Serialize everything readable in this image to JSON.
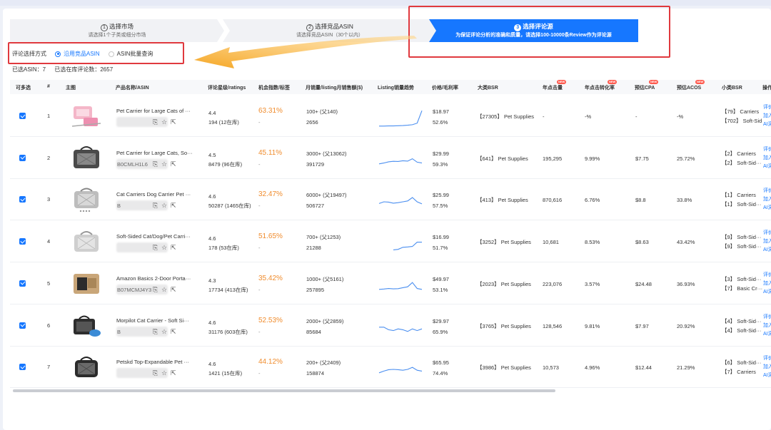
{
  "steps": [
    {
      "num": "1",
      "title": "选择市场",
      "sub": "请选择1个子类或细分市场"
    },
    {
      "num": "2",
      "title": "选择竞品ASIN",
      "sub": "请选择竞品ASIN（30个以内）"
    },
    {
      "num": "3",
      "title": "选择评论源",
      "sub": "为保证评论分析的准确和质量，请选择100-10000条Review作为评论源"
    }
  ],
  "method": {
    "label": "评论选择方式",
    "options": [
      "沿用竞品ASIN",
      "ASIN批量查询"
    ],
    "selected": "沿用竞品ASIN"
  },
  "counts": {
    "asin": "已选ASIN：7",
    "reviews": "已选在库评论数：2657"
  },
  "columns": {
    "select": "可多选",
    "index": "#",
    "image": "主图",
    "name": "产品名称/ASIN",
    "rating": "评论星级/ratings",
    "opp": "机会指数/标签",
    "sales": "月销量/listing月销售额($)",
    "trend": "Listing销量趋势",
    "price": "价格/毛利率",
    "bsr": "大类BSR",
    "clicks": "年点击量",
    "ctr": "年点击转化率",
    "cpa": "预估CPA",
    "acos": "预估ACOS",
    "subbsr": "小类BSR",
    "ops": "操作"
  },
  "new_tag": "NEW",
  "rows": [
    {
      "idx": "1",
      "name": "Pet Carrier for Large Cats of ···",
      "asin_prefix": "",
      "rating": "4.4",
      "ratings": "194 (12在库)",
      "opp": "63.31%",
      "opp2": "-",
      "sales": "100+ (父140)",
      "revenue": "2656",
      "price": "$18.97",
      "margin": "52.6%",
      "bsr": "【27305】 Pet Supplies",
      "clicks": "-",
      "ctr": "-%",
      "cpa": "-",
      "acos": "-%",
      "sub1": "【79】 Carriers",
      "sub2": "【702】 Soft-Sid",
      "op1": "评价",
      "op2": "加入",
      "op3": "AI洞",
      "trend": [
        0.05,
        0.05,
        0.06,
        0.06,
        0.07,
        0.08,
        0.1,
        0.13,
        0.22,
        0.95
      ]
    },
    {
      "idx": "2",
      "name": "Pet Carrier for Large Cats, So···",
      "asin_prefix": "B0CMLH1L6",
      "rating": "4.5",
      "ratings": "8479 (96在库)",
      "opp": "45.11%",
      "opp2": "-",
      "sales": "3000+ (父13062)",
      "revenue": "391729",
      "price": "$29.99",
      "margin": "59.3%",
      "bsr": "【641】 Pet Supplies",
      "clicks": "195,295",
      "ctr": "9.99%",
      "cpa": "$7.75",
      "acos": "25.72%",
      "sub1": "【2】 Carriers",
      "sub2": "【2】 Soft-Sid···",
      "op1": "评价",
      "op2": "加入",
      "op3": "AI洞",
      "trend": [
        0.3,
        0.35,
        0.42,
        0.45,
        0.44,
        0.48,
        0.46,
        0.6,
        0.4,
        0.35
      ]
    },
    {
      "idx": "3",
      "name": "Cat Carriers Dog Carrier Pet ···",
      "asin_prefix": "B",
      "rating": "4.6",
      "ratings": "50287 (1465在库)",
      "opp": "32.47%",
      "opp2": "-",
      "sales": "6000+ (父19497)",
      "revenue": "506727",
      "price": "$25.99",
      "margin": "57.5%",
      "bsr": "【413】 Pet Supplies",
      "clicks": "870,616",
      "ctr": "6.76%",
      "cpa": "$8.8",
      "acos": "33.8%",
      "sub1": "【1】 Carriers",
      "sub2": "【1】 Soft-Sid···",
      "op1": "评价",
      "op2": "加入",
      "op3": "AI洞",
      "trend": [
        0.4,
        0.5,
        0.48,
        0.42,
        0.45,
        0.5,
        0.55,
        0.75,
        0.5,
        0.38
      ]
    },
    {
      "idx": "4",
      "name": "Soft-Sided Cat/Dog/Pet Carri···",
      "asin_prefix": "",
      "rating": "4.6",
      "ratings": "178 (53在库)",
      "opp": "51.65%",
      "opp2": "-",
      "sales": "700+ (父1253)",
      "revenue": "21288",
      "price": "$16.99",
      "margin": "51.7%",
      "bsr": "【3252】 Pet Supplies",
      "clicks": "10,681",
      "ctr": "8.53%",
      "cpa": "$8.63",
      "acos": "43.42%",
      "sub1": "【9】 Soft-Sid···",
      "sub2": "【9】 Soft-Sid···",
      "op1": "评价",
      "op2": "加入",
      "op3": "AI洞",
      "trend": [
        null,
        null,
        null,
        0.15,
        0.18,
        0.3,
        0.32,
        0.35,
        0.6,
        0.6
      ]
    },
    {
      "idx": "5",
      "name": "Amazon Basics 2-Door Porta···",
      "asin_prefix": "B07MCMJ4Y3",
      "rating": "4.3",
      "ratings": "17734 (413在库)",
      "opp": "35.42%",
      "opp2": "-",
      "sales": "1000+ (父5161)",
      "revenue": "257895",
      "price": "$49.97",
      "margin": "53.1%",
      "bsr": "【2023】 Pet Supplies",
      "clicks": "223,076",
      "ctr": "3.57%",
      "cpa": "$24.48",
      "acos": "36.93%",
      "sub1": "【3】 Soft-Sid···",
      "sub2": "【7】 Basic Cr···",
      "op1": "评价",
      "op2": "加入",
      "op3": "AI洞",
      "trend": [
        0.3,
        0.32,
        0.35,
        0.33,
        0.34,
        0.4,
        0.45,
        0.7,
        0.35,
        0.3
      ]
    },
    {
      "idx": "6",
      "name": "Morpilot Cat Carrier - Soft Si···",
      "asin_prefix": "B",
      "rating": "4.6",
      "ratings": "31176 (603在库)",
      "opp": "52.53%",
      "opp2": "-",
      "sales": "2000+ (父2859)",
      "revenue": "85684",
      "price": "$29.97",
      "margin": "65.9%",
      "bsr": "【3765】 Pet Supplies",
      "clicks": "128,546",
      "ctr": "9.81%",
      "cpa": "$7.97",
      "acos": "20.92%",
      "sub1": "【4】 Soft-Sid···",
      "sub2": "【4】 Soft-Sid···",
      "op1": "评价",
      "op2": "加入",
      "op3": "AI洞",
      "trend": [
        0.55,
        0.55,
        0.4,
        0.35,
        0.45,
        0.4,
        0.3,
        0.45,
        0.35,
        0.45
      ]
    },
    {
      "idx": "7",
      "name": "Petskd Top-Expandable Pet ···",
      "asin_prefix": "",
      "rating": "4.6",
      "ratings": "1421 (15在库)",
      "opp": "44.12%",
      "opp2": "-",
      "sales": "200+ (父2409)",
      "revenue": "158874",
      "price": "$65.95",
      "margin": "74.4%",
      "bsr": "【3986】 Pet Supplies",
      "clicks": "10,573",
      "ctr": "4.96%",
      "cpa": "$12.44",
      "acos": "21.29%",
      "sub1": "【6】 Soft-Sid···",
      "sub2": "【7】 Carriers",
      "op1": "评价",
      "op2": "加入",
      "op3": "AI洞",
      "trend": [
        0.3,
        0.4,
        0.48,
        0.5,
        0.48,
        0.45,
        0.5,
        0.62,
        0.45,
        0.4
      ]
    }
  ]
}
